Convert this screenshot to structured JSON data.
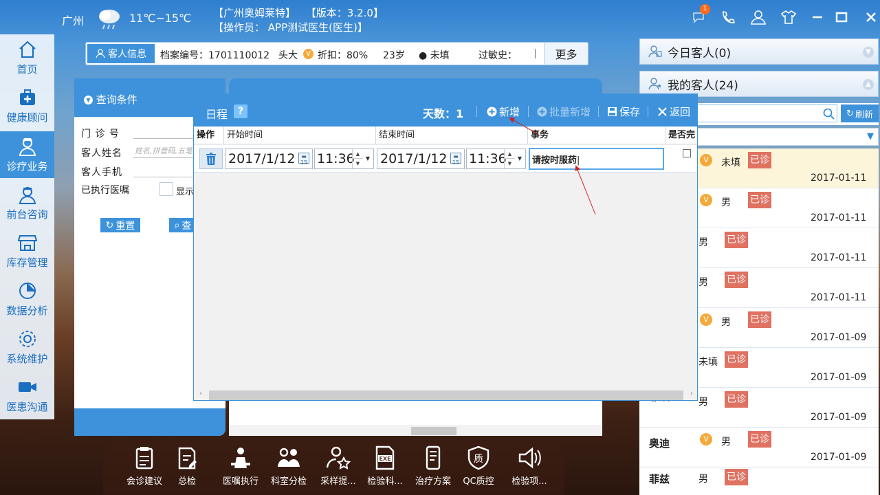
{
  "header": {
    "city": "广州",
    "temperature": "11℃~15℃",
    "company": "【广州奥姆莱特】",
    "version": "【版本：3.2.0】",
    "operator": "【操作员： APP测试医生(医生)】",
    "message_badge": "1"
  },
  "sidebar": {
    "items": [
      {
        "label": "首页",
        "icon": "home-icon"
      },
      {
        "label": "健康顾问",
        "icon": "medkit-icon"
      },
      {
        "label": "诊疗业务",
        "icon": "doctor-icon"
      },
      {
        "label": "前台咨询",
        "icon": "nurse-icon"
      },
      {
        "label": "库存管理",
        "icon": "store-icon"
      },
      {
        "label": "数据分析",
        "icon": "chart-icon"
      },
      {
        "label": "系统维护",
        "icon": "gear-icon"
      },
      {
        "label": "医患沟通",
        "icon": "video-icon"
      }
    ]
  },
  "customer_bar": {
    "tab_label": "客人信息",
    "file_no": "档案编号：1701110012",
    "name": "头大",
    "vip": "V",
    "discount": "折扣：80%",
    "age": "23岁",
    "gender": "未填",
    "allergy": "过敏史：",
    "allergy_cut": "∣",
    "more": "更多"
  },
  "query": {
    "title": "查询条件",
    "clinic_no_label": "门 诊 号",
    "name_label": "客人姓名",
    "name_placeholder": "姓名,拼音码,五笔码",
    "phone_label": "客人手机",
    "executed_label": "已执行医嘱",
    "show_label": "显示",
    "reset_label": "重置",
    "search_label": "查"
  },
  "dialog": {
    "title": "日程",
    "days": "天数：1",
    "add": "新增",
    "batch_add": "批量新增",
    "save": "保存",
    "back": "返回",
    "columns": [
      "操作",
      "开始时间",
      "结束时间",
      "事务",
      "是否完"
    ],
    "row": {
      "start_date": "2017/1/12",
      "start_time": "11:36",
      "end_date": "2017/1/12",
      "end_time": "11:36",
      "task": "请按时服药"
    }
  },
  "right_panel": {
    "today_label": "今日客人(0)",
    "mine_label": "我的客人(24)",
    "refresh": "刷新",
    "customers": [
      {
        "name": "",
        "vip": "V",
        "gender": "未填",
        "status": "已诊",
        "date": "2017-01-11"
      },
      {
        "name": "",
        "vip": "V",
        "gender": "男",
        "status": "已诊",
        "date": "2017-01-11"
      },
      {
        "name": "",
        "vip": "",
        "gender": "男",
        "status": "已诊",
        "date": "2017-01-11"
      },
      {
        "name": "",
        "vip": "",
        "gender": "男",
        "status": "已诊",
        "date": "2017-01-11"
      },
      {
        "name": "",
        "vip": "V",
        "gender": "男",
        "status": "已诊",
        "date": "2017-01-09"
      },
      {
        "name": "",
        "vip": "",
        "gender": "未填",
        "status": "已诊",
        "date": "2017-01-09"
      },
      {
        "name": "菲兹",
        "vip": "",
        "gender": "男",
        "status": "已诊",
        "date": "2017-01-09"
      },
      {
        "name": "奥迪",
        "vip": "V",
        "gender": "男",
        "status": "已诊",
        "date": "2017-01-09"
      },
      {
        "name": "菲兹",
        "vip": "",
        "gender": "男",
        "status": "已诊",
        "date": ""
      }
    ]
  },
  "toolbar": {
    "items": [
      "会诊建议",
      "总检",
      "医嘱执行",
      "科室分检",
      "采样提...",
      "检验科...",
      "治疗方案",
      "QC质控",
      "检验项..."
    ]
  }
}
